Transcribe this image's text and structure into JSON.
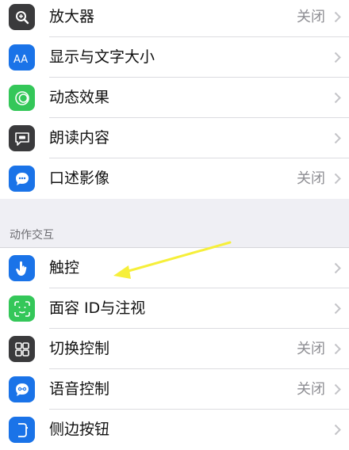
{
  "vision_group": {
    "items": [
      {
        "label": "放大器",
        "value": "关闭",
        "icon": "zoom-icon",
        "color": "#333333"
      },
      {
        "label": "显示与文字大小",
        "value": "",
        "icon": "text-size-icon",
        "color": "#1a73e8"
      },
      {
        "label": "动态效果",
        "value": "",
        "icon": "motion-icon",
        "color": "#34c759"
      },
      {
        "label": "朗读内容",
        "value": "",
        "icon": "speech-bubble-icon",
        "color": "#444444"
      },
      {
        "label": "口述影像",
        "value": "关闭",
        "icon": "audio-description-icon",
        "color": "#1a73e8"
      }
    ]
  },
  "interaction_section": {
    "header": "动作交互",
    "items": [
      {
        "label": "触控",
        "value": "",
        "icon": "hand-touch-icon",
        "color": "#1a73e8"
      },
      {
        "label": "面容 ID与注视",
        "value": "",
        "icon": "face-id-icon",
        "color": "#34c759"
      },
      {
        "label": "切换控制",
        "value": "关闭",
        "icon": "switch-control-icon",
        "color": "#333333"
      },
      {
        "label": "语音控制",
        "value": "关闭",
        "icon": "voice-control-icon",
        "color": "#1a73e8"
      },
      {
        "label": "侧边按钮",
        "value": "",
        "icon": "side-button-icon",
        "color": "#1a73e8"
      }
    ]
  },
  "annotation": {
    "color": "#f6ef3a"
  }
}
